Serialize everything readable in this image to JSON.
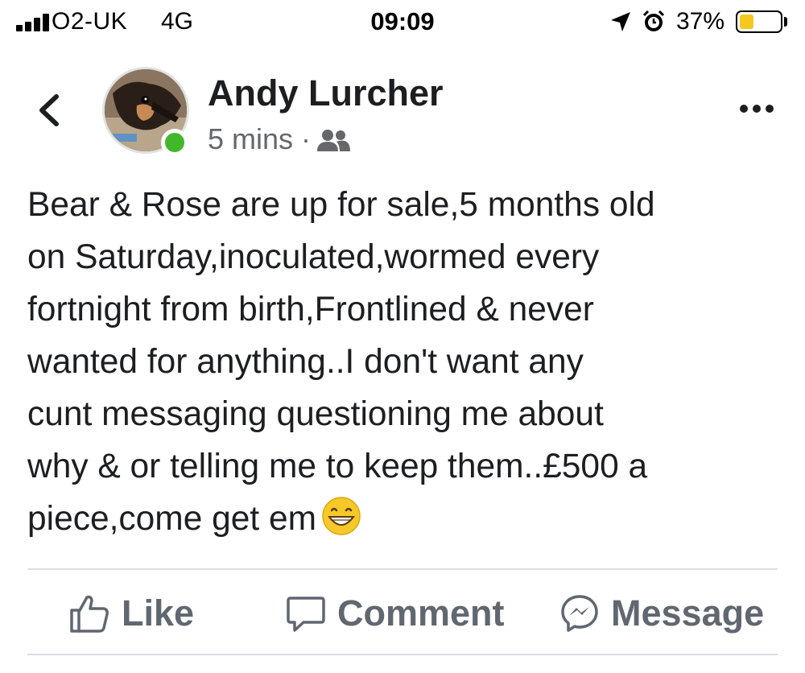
{
  "status_bar": {
    "carrier": "O2-UK",
    "network": "4G",
    "time": "09:09",
    "battery_percent_label": "37%",
    "battery_level": 0.37,
    "battery_color": "#f3c81f",
    "icons": [
      "signal-icon",
      "location-icon",
      "alarm-icon",
      "battery-icon"
    ]
  },
  "post": {
    "author": "Andy Lurcher",
    "timestamp": "5 mins",
    "separator": "·",
    "audience_icon": "group-icon",
    "online_color": "#42b72a",
    "text": "Bear & Rose are up for sale,5 months old\non Saturday,inoculated,wormed every\nfortnight from birth,Frontlined & never\nwanted for anything..I don't want any\ncunt messaging questioning me about\nwhy & or telling me to keep them..£500 a\npiece,come get em",
    "emoji": "grinning-face-emoji"
  },
  "actions": {
    "like": "Like",
    "comment": "Comment",
    "message": "Message"
  }
}
